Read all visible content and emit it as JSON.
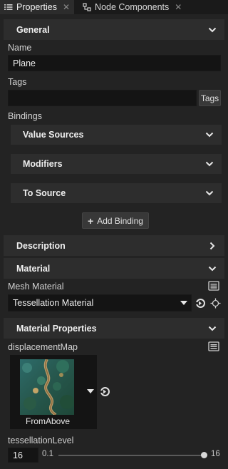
{
  "tabs": [
    {
      "label": "Properties",
      "icon": "list-icon",
      "active": true
    },
    {
      "label": "Node Components",
      "icon": "node-components-icon",
      "active": false
    }
  ],
  "general": {
    "header": "General",
    "name_label": "Name",
    "name_value": "Plane",
    "tags_label": "Tags",
    "tags_value": "",
    "tags_button": "Tags",
    "bindings_label": "Bindings",
    "value_sources": "Value Sources",
    "modifiers": "Modifiers",
    "to_source": "To Source",
    "add_binding": "Add Binding"
  },
  "description": {
    "header": "Description"
  },
  "material": {
    "header": "Material",
    "mesh_material_label": "Mesh Material",
    "mesh_material_value": "Tessellation Material"
  },
  "material_properties": {
    "header": "Material Properties",
    "displacement_label": "displacementMap",
    "texture_name": "FromAbove",
    "tessellation_label": "tessellationLevel",
    "tessellation_value": "16",
    "slider_min": "0.1",
    "slider_max": "16",
    "slider_fraction": 1.0
  },
  "colors": {
    "background": "#232323",
    "header": "#2d2d2d",
    "field": "#141414",
    "accent_text": "#f0f0f0"
  }
}
